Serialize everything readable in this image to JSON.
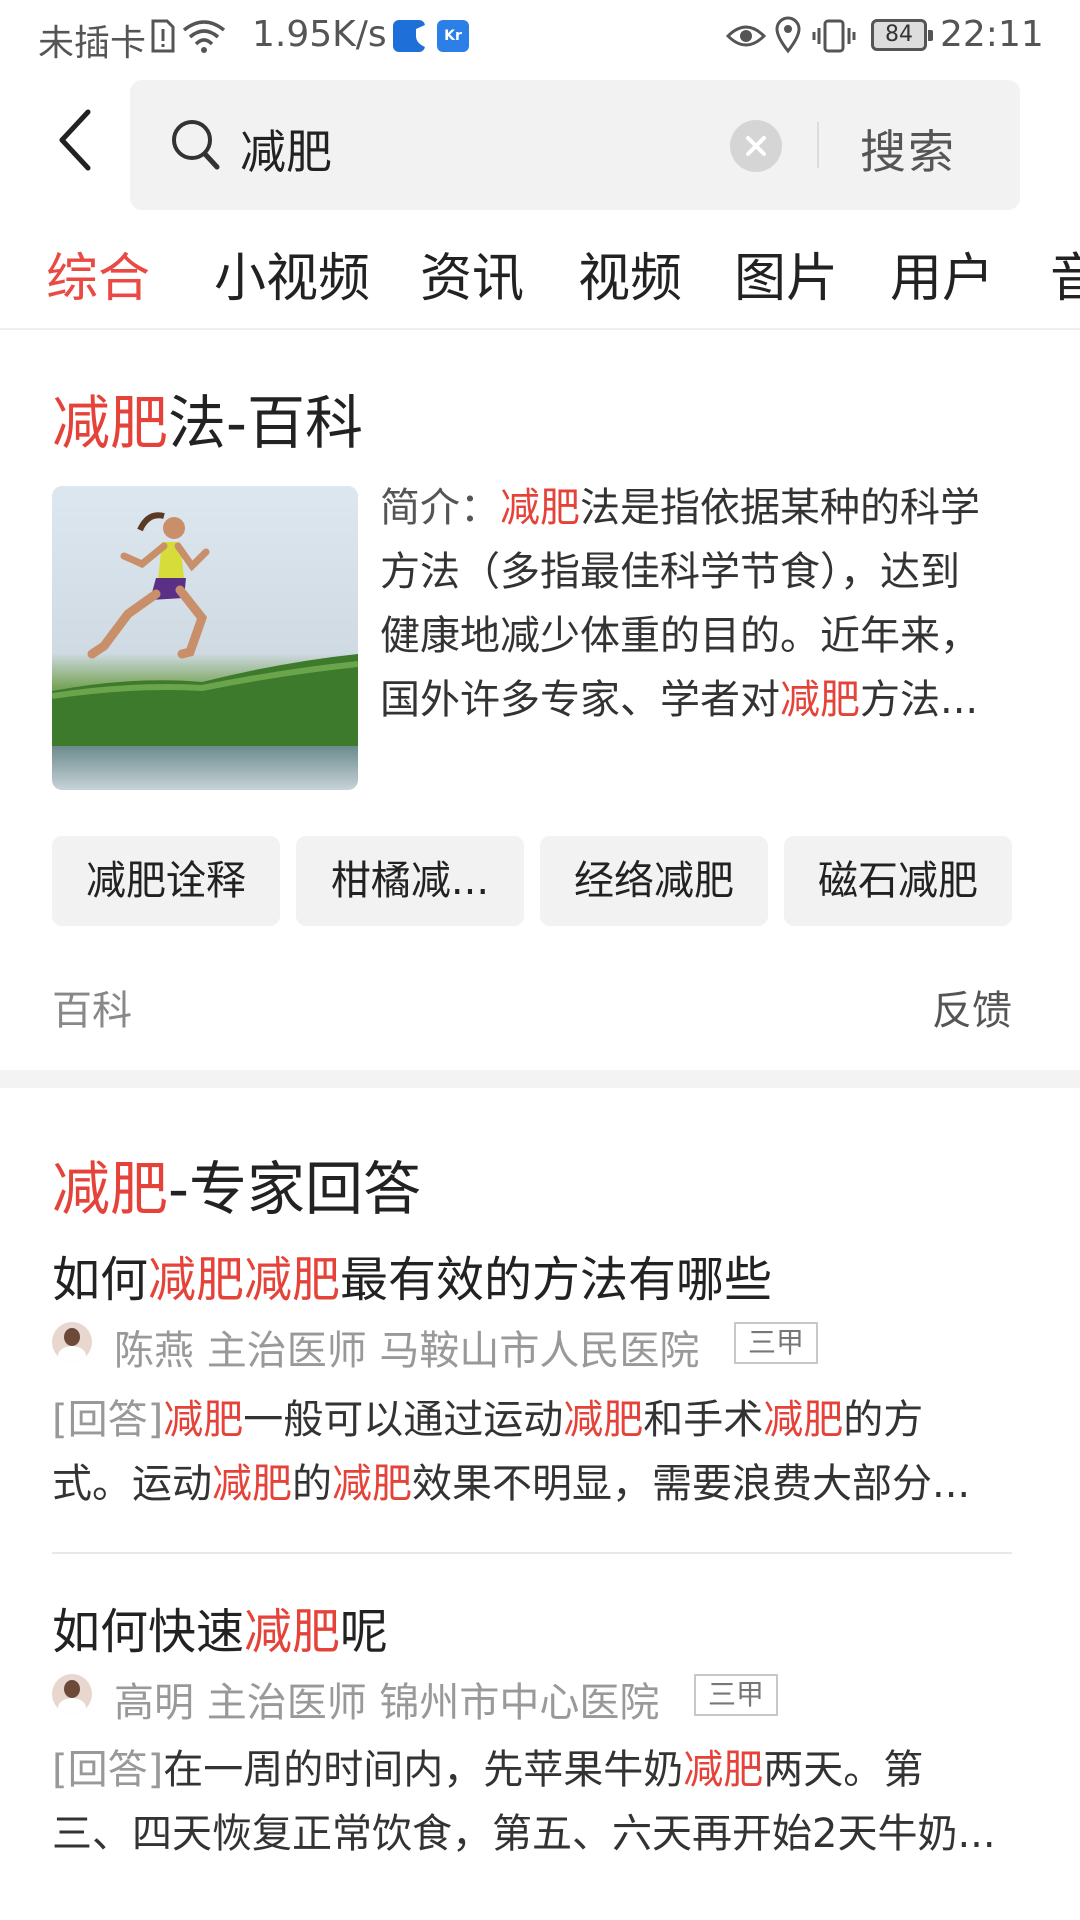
{
  "status_bar": {
    "carrier": "未插卡",
    "speed": "1.95K/s",
    "battery": "84",
    "time": "22:11"
  },
  "search": {
    "value": "减肥",
    "button": "搜索"
  },
  "tabs": [
    "综合",
    "小视频",
    "资讯",
    "视频",
    "图片",
    "用户",
    "音"
  ],
  "encyclopedia": {
    "title_hl": "减肥",
    "title_rest": "法-百科",
    "summary": {
      "label": "简介：",
      "l1_hl": "减肥",
      "l1_rest": "法是指依据某种的科学",
      "l2": "方法（多指最佳科学节食），达到",
      "l3": "健康地减少体重的目的。近年来，",
      "l4_a": "国外许多专家、学者对",
      "l4_hl": "减肥",
      "l4_b": "方法..."
    },
    "chips": [
      "减肥诠释",
      "柑橘减...",
      "经络减肥",
      "磁石减肥"
    ],
    "source": "百科",
    "feedback": "反馈"
  },
  "experts": {
    "title_hl": "减肥",
    "title_rest": "-专家回答",
    "items": [
      {
        "q_a": "如何",
        "q_hl": "减肥减肥",
        "q_b": "最有效的方法有哪些",
        "doctor": "陈燕 主治医师 马鞍山市人民医院",
        "badge": "三甲",
        "label": "[回答]",
        "a1_hl1": "减肥",
        "a1_t1": "一般可以通过运动",
        "a1_hl2": "减肥",
        "a1_t2": "和手术",
        "a1_hl3": "减肥",
        "a1_t3": "的方",
        "a2_t1": "式。运动",
        "a2_hl1": "减肥",
        "a2_t2": "的",
        "a2_hl2": "减肥",
        "a2_t3": "效果不明显，需要浪费大部分..."
      },
      {
        "q_a": "如何快速",
        "q_hl": "减肥",
        "q_b": "呢",
        "doctor": "高明 主治医师 锦州市中心医院",
        "badge": "三甲",
        "label": "[回答]",
        "a1_t1": "在一周的时间内，先苹果牛奶",
        "a1_hl1": "减肥",
        "a1_t2": "两天。第",
        "a2": "三、四天恢复正常饮食，第五、六天再开始2天牛奶..."
      }
    ]
  }
}
